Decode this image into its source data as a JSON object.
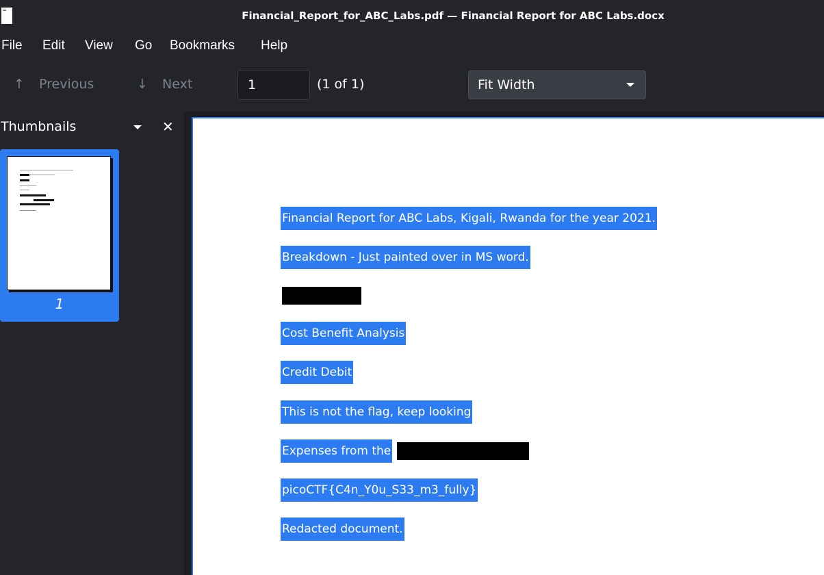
{
  "window": {
    "title": "Financial_Report_for_ABC_Labs.pdf — Financial Report for ABC Labs.docx"
  },
  "menu": [
    "File",
    "Edit",
    "View",
    "Go",
    "Bookmarks",
    "Help"
  ],
  "toolbar": {
    "previous_label": "Previous",
    "previous_icon": "arrow-up-icon",
    "next_label": "Next",
    "next_icon": "arrow-down-icon",
    "page_value": "1",
    "page_count": "(1 of 1)",
    "zoom_value": "Fit Width"
  },
  "sidebar": {
    "title": "Thumbnails",
    "thumbnail_page_label": "1"
  },
  "document": {
    "lines": [
      "Financial Report for ABC Labs, Kigali, Rwanda for the year 2021.",
      "Breakdown - Just painted over in MS word.",
      "Cost Benefit Analysis",
      "Credit Debit",
      "This is not the flag, keep looking",
      "Expenses from the",
      "picoCTF{C4n_Y0u_S33_m3_fully}",
      "Redacted document."
    ]
  },
  "colors": {
    "accent": "#2d7bf0",
    "window_bg": "#23252b",
    "redaction": "#000000"
  }
}
